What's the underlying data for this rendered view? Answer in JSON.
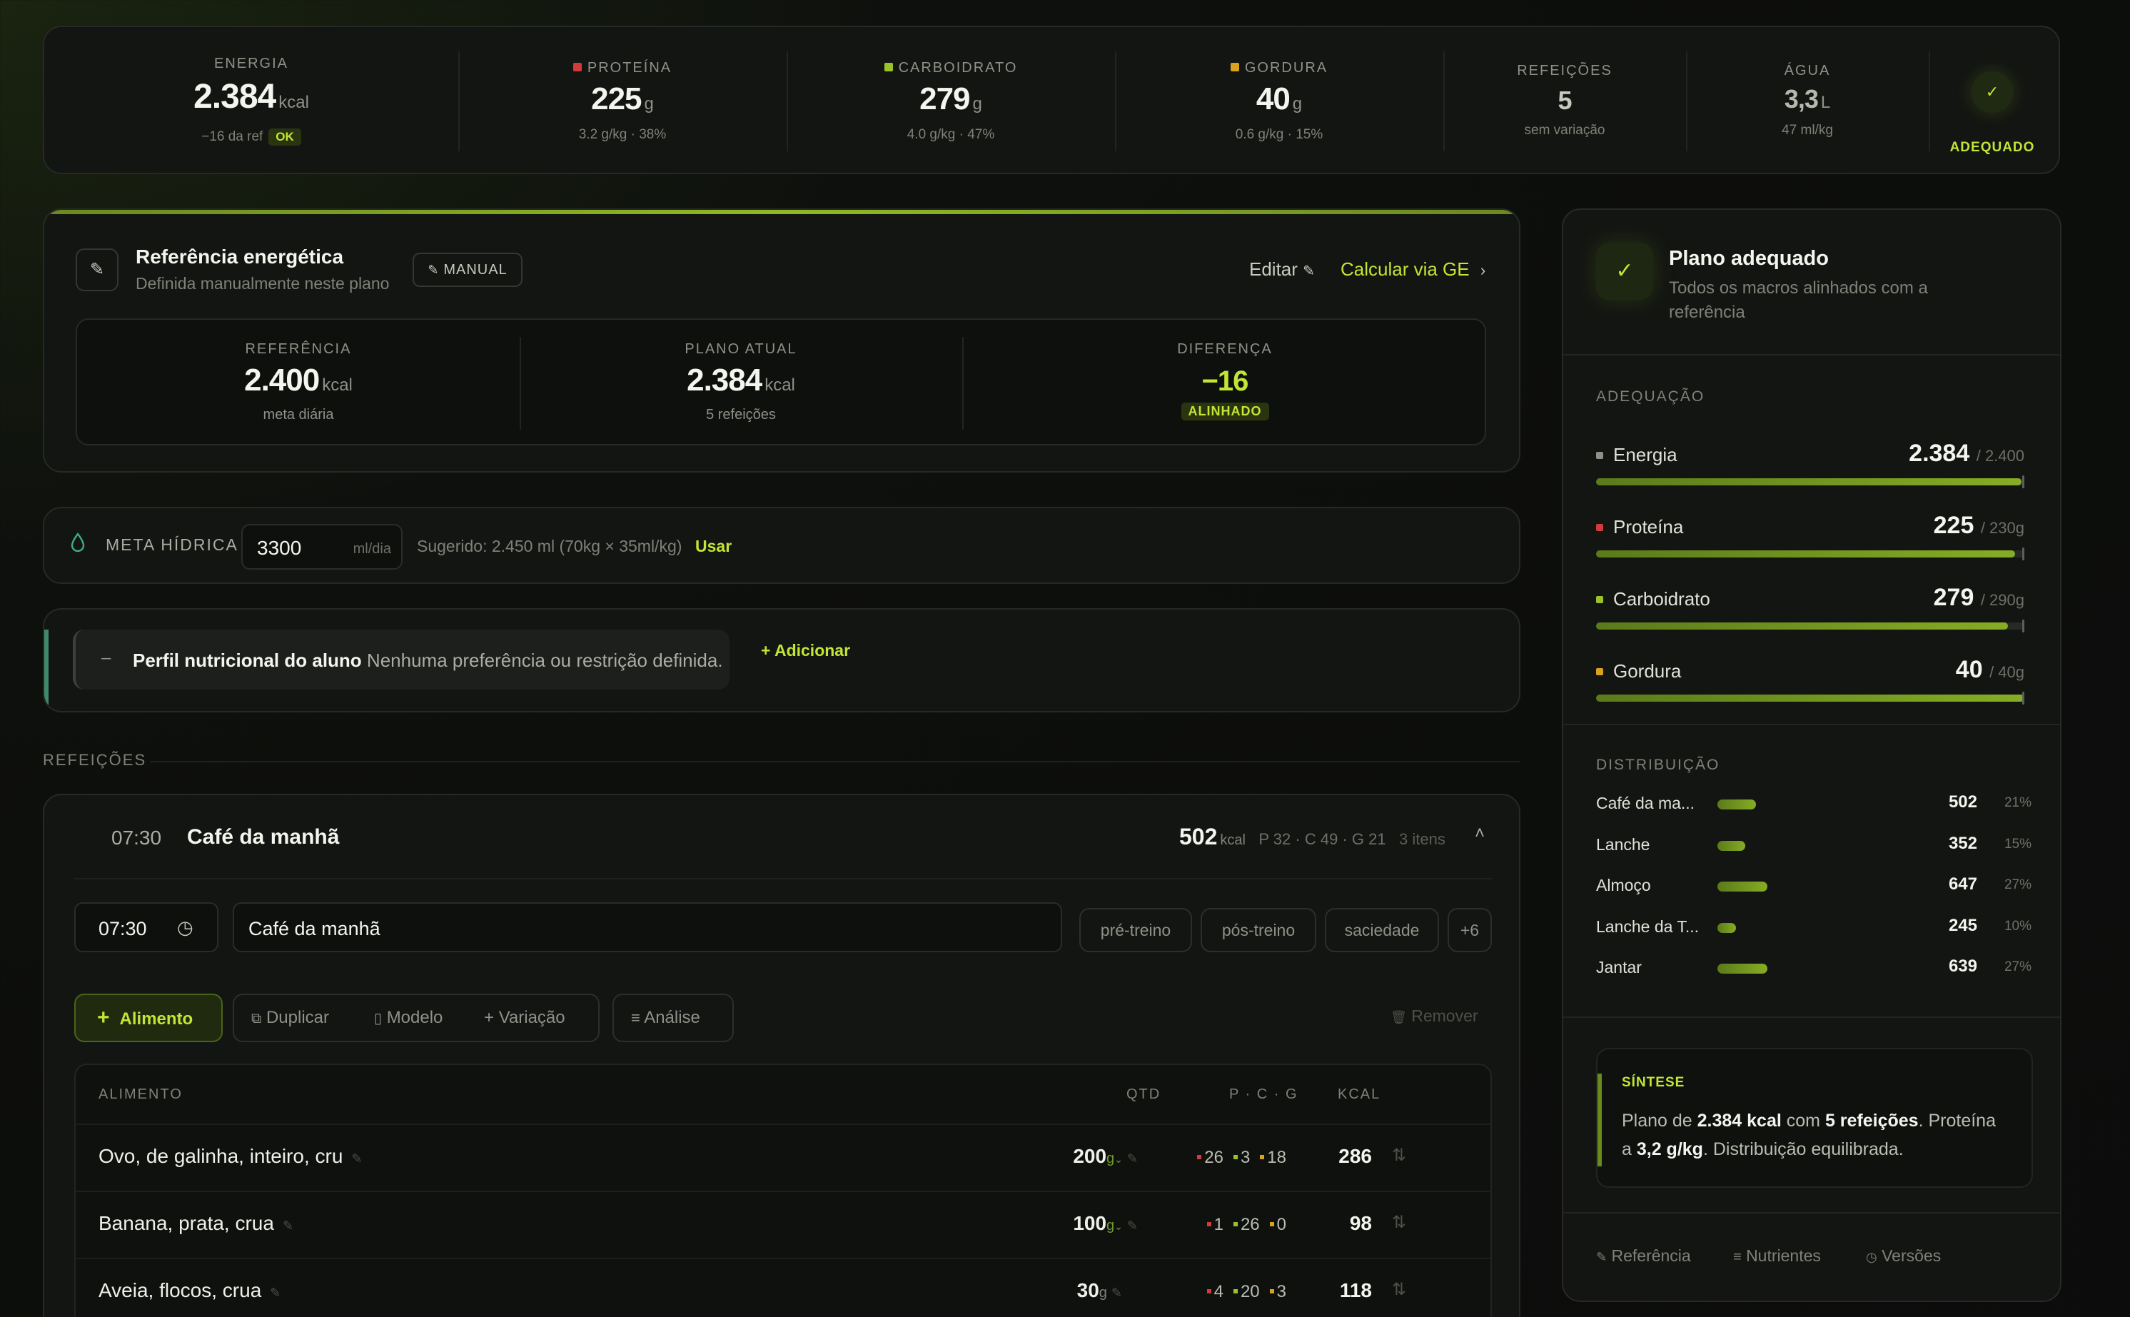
{
  "summary": {
    "energia": {
      "label": "ENERGIA",
      "value": "2.384",
      "unit": "kcal",
      "sub": "−16 da ref",
      "badge": "OK"
    },
    "proteina": {
      "label": "PROTEÍNA",
      "value": "225",
      "unit": "g",
      "sub": "3.2 g/kg · 38%",
      "color": "#d23b3b"
    },
    "carboidrato": {
      "label": "CARBOIDRATO",
      "value": "279",
      "unit": "g",
      "sub": "4.0 g/kg · 47%",
      "color": "#9cc22a"
    },
    "gordura": {
      "label": "GORDURA",
      "value": "40",
      "unit": "g",
      "sub": "0.6 g/kg · 15%",
      "color": "#d8a21e"
    },
    "refeicoes": {
      "label": "REFEIÇÕES",
      "value": "5",
      "sub": "sem variação"
    },
    "agua": {
      "label": "ÁGUA",
      "value": "3,3",
      "unit": "L",
      "sub": "47 ml/kg"
    },
    "status": {
      "icon": "check-icon",
      "label": "ADEQUADO"
    }
  },
  "referencia": {
    "title": "Referência energética",
    "subtitle": "Definida manualmente neste plano",
    "mode_badge": "MANUAL",
    "edit_label": "Editar",
    "calc_label": "Calcular via GE",
    "cols": [
      {
        "label": "REFERÊNCIA",
        "value": "2.400",
        "unit": "kcal",
        "sub": "meta diária"
      },
      {
        "label": "PLANO ATUAL",
        "value": "2.384",
        "unit": "kcal",
        "sub": "5 refeições"
      },
      {
        "label": "DIFERENÇA",
        "value": "−16",
        "badge": "ALINHADO"
      }
    ]
  },
  "hidrica": {
    "label": "META HÍDRICA",
    "value": "3300",
    "unit": "ml/dia",
    "suggestion": "Sugerido: 2.450 ml (70kg × 35ml/kg)",
    "use_label": "Usar"
  },
  "perfil": {
    "dash": "–",
    "title": "Perfil nutricional do aluno",
    "text": "Nenhuma preferência ou restrição definida.",
    "add_label": "+ Adicionar"
  },
  "refeicoes_label": "REFEIÇÕES",
  "meal": {
    "time": "07:30",
    "name": "Café da manhã",
    "kcal": "502",
    "kcal_unit": "kcal",
    "macros": "P 32 · C 49 · G 21",
    "items_count": "3 itens",
    "time_input": "07:30",
    "name_input": "Café da manhã",
    "tags": [
      "pré-treino",
      "pós-treino",
      "saciedade",
      "+6"
    ],
    "actions": {
      "alimento": "Alimento",
      "duplicar": "Duplicar",
      "modelo": "Modelo",
      "variacao": "Variação",
      "analise": "Análise",
      "remover": "Remover"
    },
    "table": {
      "headers": {
        "alimento": "ALIMENTO",
        "qtd": "QTD",
        "pcg": "P · C · G",
        "kcal": "KCAL"
      },
      "rows": [
        {
          "name": "Ovo, de galinha, inteiro, cru",
          "qty": "200",
          "unit": "g",
          "p": "26",
          "c": "3",
          "g": "18",
          "kcal": "286"
        },
        {
          "name": "Banana, prata, crua",
          "qty": "100",
          "unit": "g",
          "p": "1",
          "c": "26",
          "g": "0",
          "kcal": "98"
        },
        {
          "name": "Aveia, flocos, crua",
          "qty": "30",
          "unit": "g",
          "p": "4",
          "c": "20",
          "g": "3",
          "kcal": "118"
        }
      ]
    }
  },
  "panel": {
    "title": "Plano adequado",
    "subtitle_1": "Todos os macros alinhados com a",
    "subtitle_2": "referência",
    "adequacao_label": "ADEQUAÇÃO",
    "adequacao": [
      {
        "name": "Energia",
        "value": "2.384",
        "ref": "/ 2.400",
        "fraction": 0.993,
        "color": "#8d9288"
      },
      {
        "name": "Proteína",
        "value": "225",
        "ref": "/ 230g",
        "fraction": 0.978,
        "color": "#d23b3b"
      },
      {
        "name": "Carboidrato",
        "value": "279",
        "ref": "/ 290g",
        "fraction": 0.962,
        "color": "#9cc22a"
      },
      {
        "name": "Gordura",
        "value": "40",
        "ref": "/ 40g",
        "fraction": 1.0,
        "color": "#d8a21e"
      }
    ],
    "distribuicao_label": "DISTRIBUIÇÃO",
    "distribuicao": [
      {
        "name": "Café da ma...",
        "value": "502",
        "pct": "21%",
        "share": 0.21
      },
      {
        "name": "Lanche",
        "value": "352",
        "pct": "15%",
        "share": 0.15
      },
      {
        "name": "Almoço",
        "value": "647",
        "pct": "27%",
        "share": 0.27
      },
      {
        "name": "Lanche da T...",
        "value": "245",
        "pct": "10%",
        "share": 0.1
      },
      {
        "name": "Jantar",
        "value": "639",
        "pct": "27%",
        "share": 0.27
      }
    ],
    "sintese_label": "SÍNTESE",
    "sintese": {
      "a": "Plano de ",
      "b": "2.384 kcal",
      "c": " com ",
      "d": "5 refeições",
      "e": ". Proteína",
      "f": "a ",
      "g": "3,2 g/kg",
      "h": ". Distribuição equilibrada."
    },
    "footer": {
      "referencia": "Referência",
      "nutrientes": "Nutrientes",
      "versoes": "Versões"
    }
  }
}
